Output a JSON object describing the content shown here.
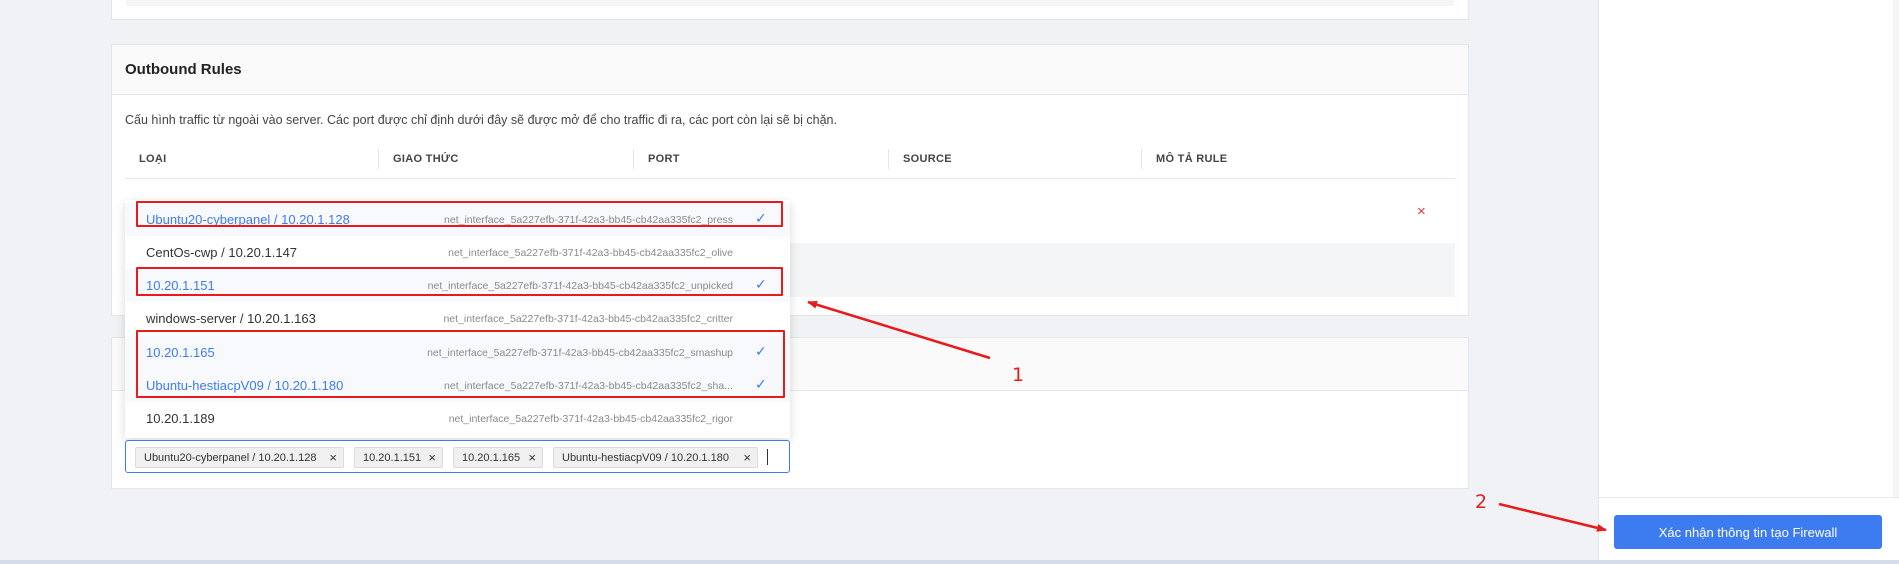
{
  "outbound": {
    "title": "Outbound Rules",
    "description": "Cấu hình traffic từ ngoài vào server. Các port được chỉ định dưới đây sẽ được mở để cho traffic đi ra, các port còn lại sẽ bị chặn.",
    "columns": [
      "LOẠI",
      "GIAO THỨC",
      "PORT",
      "SOURCE",
      "MÔ TẢ RULE"
    ],
    "remove_icon": "×"
  },
  "dropdown": {
    "options": [
      {
        "label": "Ubuntu20-cyberpanel / 10.20.1.128",
        "iface": "net_interface_5a227efb-371f-42a3-bb45-cb42aa335fc2_press",
        "selected": true
      },
      {
        "label": "CentOs-cwp / 10.20.1.147",
        "iface": "net_interface_5a227efb-371f-42a3-bb45-cb42aa335fc2_olive",
        "selected": false
      },
      {
        "label": "10.20.1.151",
        "iface": "net_interface_5a227efb-371f-42a3-bb45-cb42aa335fc2_unpicked",
        "selected": true
      },
      {
        "label": "windows-server / 10.20.1.163",
        "iface": "net_interface_5a227efb-371f-42a3-bb45-cb42aa335fc2_critter",
        "selected": false
      },
      {
        "label": "10.20.1.165",
        "iface": "net_interface_5a227efb-371f-42a3-bb45-cb42aa335fc2_smashup",
        "selected": true
      },
      {
        "label": "Ubuntu-hestiacpV09 / 10.20.1.180",
        "iface": "net_interface_5a227efb-371f-42a3-bb45-cb42aa335fc2_sha...",
        "selected": true
      },
      {
        "label": "10.20.1.189",
        "iface": "net_interface_5a227efb-371f-42a3-bb45-cb42aa335fc2_rigor",
        "selected": false
      }
    ],
    "check_icon": "✓"
  },
  "selected_tags": [
    {
      "label": "Ubuntu20-cyberpanel / 10.20.1.128"
    },
    {
      "label": "10.20.1.151"
    },
    {
      "label": "10.20.1.165"
    },
    {
      "label": "Ubuntu-hestiacpV09 / 10.20.1.180"
    }
  ],
  "tag_remove_icon": "×",
  "footer": {
    "confirm_label": "Xác nhận thông tin tạo Firewall"
  },
  "annotations": {
    "label_1": "1",
    "label_2": "2",
    "color": "#e61c1c"
  },
  "colors": {
    "accent": "#3d7cf0",
    "danger": "#e53935"
  }
}
